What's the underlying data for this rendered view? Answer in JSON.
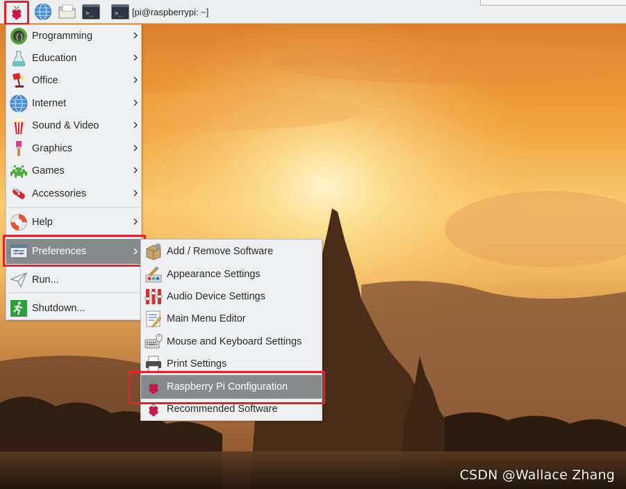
{
  "taskbar": {
    "buttons": [
      {
        "name": "raspberry-menu-button",
        "icon": "raspberry-icon"
      },
      {
        "name": "web-browser-button",
        "icon": "globe-icon"
      },
      {
        "name": "file-manager-button",
        "icon": "folder-icon"
      },
      {
        "name": "terminal-button",
        "icon": "terminal-icon"
      }
    ],
    "window_task": {
      "icon": "terminal-icon",
      "label": "[pi@raspberrypi: ~]"
    }
  },
  "main_menu": {
    "items": [
      {
        "label": "Programming",
        "icon": "programming-icon",
        "has_submenu": true
      },
      {
        "label": "Education",
        "icon": "education-flask-icon",
        "has_submenu": true
      },
      {
        "label": "Office",
        "icon": "office-lamp-icon",
        "has_submenu": true
      },
      {
        "label": "Internet",
        "icon": "globe-icon",
        "has_submenu": true
      },
      {
        "label": "Sound & Video",
        "icon": "popcorn-icon",
        "has_submenu": true
      },
      {
        "label": "Graphics",
        "icon": "paintbrush-icon",
        "has_submenu": true
      },
      {
        "label": "Games",
        "icon": "space-invader-icon",
        "has_submenu": true
      },
      {
        "label": "Accessories",
        "icon": "swiss-knife-icon",
        "has_submenu": true
      },
      {
        "label": "Help",
        "icon": "lifebuoy-icon",
        "has_submenu": true
      },
      {
        "label": "Preferences",
        "icon": "preferences-panel-icon",
        "has_submenu": true,
        "highlighted": true
      },
      {
        "label": "Run...",
        "icon": "paper-plane-icon",
        "has_submenu": false
      },
      {
        "label": "Shutdown...",
        "icon": "exit-running-man-icon",
        "has_submenu": false
      }
    ]
  },
  "preferences_submenu": {
    "items": [
      {
        "label": "Add / Remove Software",
        "icon": "package-icon"
      },
      {
        "label": "Appearance Settings",
        "icon": "appearance-icon"
      },
      {
        "label": "Audio Device Settings",
        "icon": "audio-mixer-icon"
      },
      {
        "label": "Main Menu Editor",
        "icon": "menu-editor-icon"
      },
      {
        "label": "Mouse and Keyboard Settings",
        "icon": "keyboard-mouse-icon"
      },
      {
        "label": "Print Settings",
        "icon": "printer-icon"
      },
      {
        "label": "Raspberry Pi Configuration",
        "icon": "raspberry-icon",
        "highlighted": true
      },
      {
        "label": "Recommended Software",
        "icon": "raspberry-icon"
      }
    ]
  },
  "watermark": "CSDN @Wallace Zhang",
  "colors": {
    "menu_background": "#eff0f1",
    "highlight": "#878a8d",
    "annotation_red": "#e8202a",
    "taskbar": "#edeeef"
  }
}
